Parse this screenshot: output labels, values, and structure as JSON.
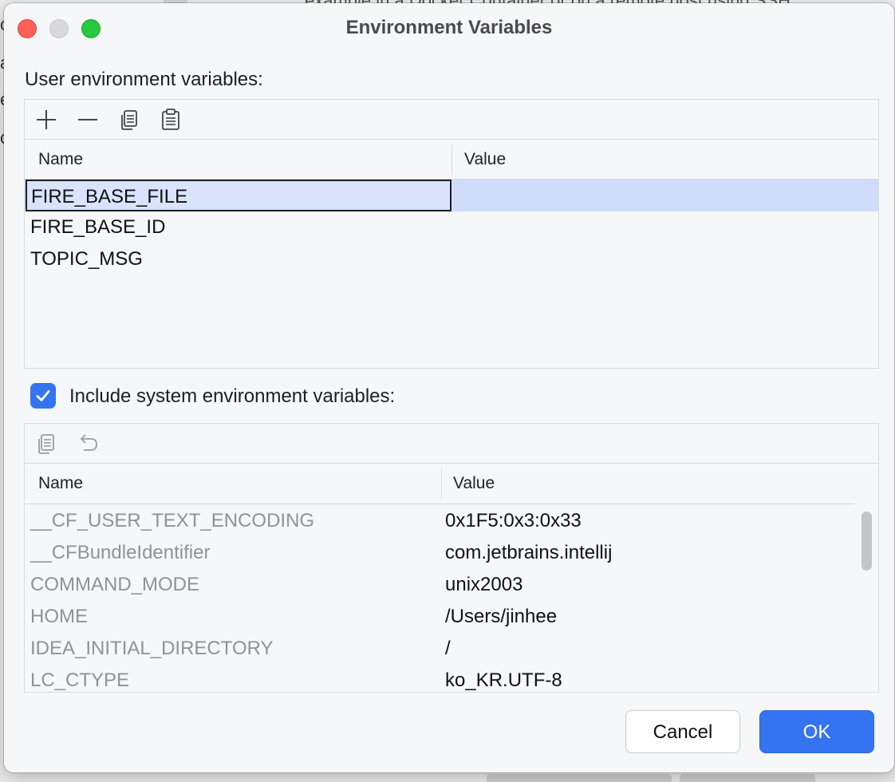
{
  "background": {
    "caption": "example in a Docker Container or on a remote host using SSH.",
    "edge_letters": [
      "c",
      "a",
      "e",
      "o"
    ]
  },
  "dialog": {
    "title": "Environment Variables"
  },
  "user_section": {
    "label": "User environment variables:",
    "toolbar": [
      {
        "name": "add",
        "icon": "plus-icon"
      },
      {
        "name": "remove",
        "icon": "minus-icon"
      },
      {
        "name": "copy",
        "icon": "copy-icon"
      },
      {
        "name": "paste",
        "icon": "paste-icon"
      }
    ],
    "columns": [
      "Name",
      "Value"
    ],
    "rows": [
      {
        "name": "FIRE_BASE_FILE",
        "value": "",
        "selected": true
      },
      {
        "name": "FIRE_BASE_ID",
        "value": ""
      },
      {
        "name": "TOPIC_MSG",
        "value": ""
      }
    ]
  },
  "system_section": {
    "checkbox_checked": true,
    "label": "Include system environment variables:",
    "toolbar": [
      {
        "name": "copy",
        "icon": "copy-icon"
      },
      {
        "name": "undo",
        "icon": "undo-icon"
      }
    ],
    "columns": [
      "Name",
      "Value"
    ],
    "rows": [
      {
        "name": "__CF_USER_TEXT_ENCODING",
        "value": "0x1F5:0x3:0x33"
      },
      {
        "name": "__CFBundleIdentifier",
        "value": "com.jetbrains.intellij"
      },
      {
        "name": "COMMAND_MODE",
        "value": "unix2003"
      },
      {
        "name": "HOME",
        "value": "/Users/jinhee"
      },
      {
        "name": "IDEA_INITIAL_DIRECTORY",
        "value": "/"
      },
      {
        "name": "LC_CTYPE",
        "value": "ko_KR.UTF-8"
      }
    ]
  },
  "buttons": {
    "cancel": "Cancel",
    "ok": "OK"
  },
  "colors": {
    "accent": "#3574f0",
    "selection": "#cfdcfb",
    "muted_text": "#8e929b"
  }
}
